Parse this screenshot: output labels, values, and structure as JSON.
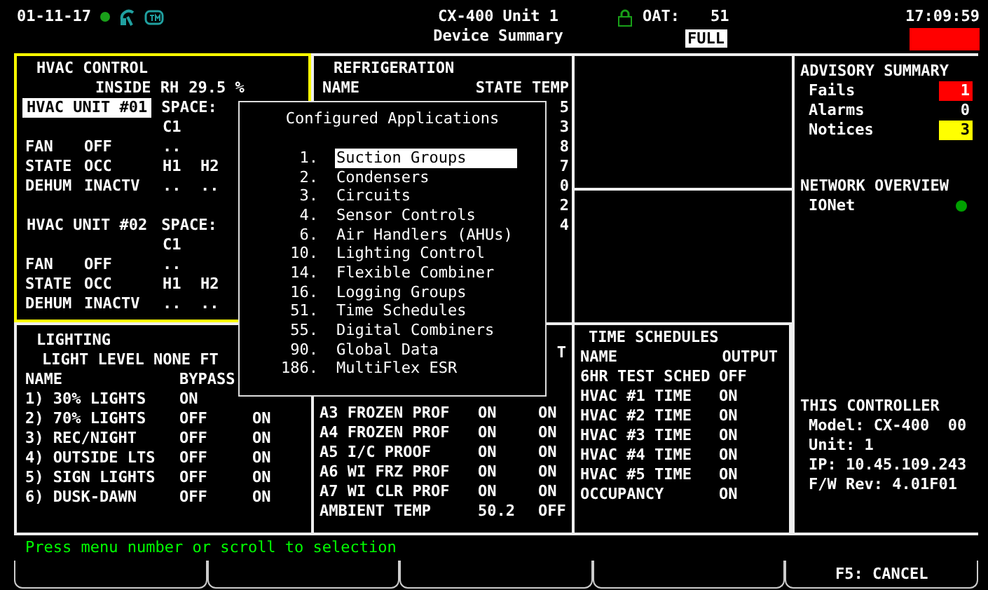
{
  "header": {
    "date": "01-11-17",
    "title": "CX-400 Unit 1",
    "subtitle": "Device Summary",
    "oat_label": "OAT:",
    "oat_value": "51",
    "time": "17:09:59",
    "mode_badge": "FULL",
    "alarm_active": true
  },
  "hvac_control": {
    "title": "HVAC CONTROL",
    "highlighted": true,
    "inside_rh_label": "INSIDE RH",
    "inside_rh": "29.5 %",
    "units": [
      {
        "name": "HVAC UNIT #01",
        "selected": true,
        "space_label": "SPACE:",
        "rows": [
          {
            "stages": [
              "C1"
            ]
          },
          {
            "label": "FAN",
            "value": "OFF",
            "stages": [
              ".."
            ]
          },
          {
            "label": "STATE",
            "value": "OCC",
            "stages": [
              "H1",
              "H2"
            ]
          },
          {
            "label": "DEHUM",
            "value": "INACTV",
            "stages": [
              "..",
              ".."
            ]
          }
        ]
      },
      {
        "name": "HVAC UNIT #02",
        "selected": false,
        "space_label": "SPACE:",
        "rows": [
          {
            "stages": [
              "C1"
            ]
          },
          {
            "label": "FAN",
            "value": "OFF",
            "stages": [
              ".."
            ]
          },
          {
            "label": "STATE",
            "value": "OCC",
            "stages": [
              "H1",
              "H2"
            ]
          },
          {
            "label": "DEHUM",
            "value": "INACTV",
            "stages": [
              "..",
              ".."
            ]
          }
        ]
      }
    ]
  },
  "refrigeration": {
    "title": "REFRIGERATION",
    "columns": [
      "NAME",
      "STATE",
      "TEMP"
    ],
    "temps": [
      "5",
      "3",
      "8",
      "7",
      "0",
      "2",
      "4"
    ]
  },
  "refrigeration_lower": {
    "column_tail": "T",
    "rows": [
      {
        "name": "A3 FROZEN PROF",
        "state": "ON",
        "output": "ON"
      },
      {
        "name": "A4 FROZEN PROF",
        "state": "ON",
        "output": "ON"
      },
      {
        "name": "A5 I/C PROOF",
        "state": "ON",
        "output": "ON"
      },
      {
        "name": "A6 WI FRZ PROF",
        "state": "ON",
        "output": "ON"
      },
      {
        "name": "A7 WI CLR PROF",
        "state": "ON",
        "output": "ON"
      },
      {
        "name": "AMBIENT TEMP",
        "state": "50.2",
        "output": "OFF"
      }
    ]
  },
  "lighting": {
    "title": "LIGHTING",
    "subtitle": "LIGHT LEVEL NONE FT",
    "columns": [
      "NAME",
      "BYPASS"
    ],
    "rows": [
      {
        "name": "1) 30% LIGHTS",
        "bypass": "ON"
      },
      {
        "name": "2) 70% LIGHTS",
        "bypass": "OFF",
        "output": "ON"
      },
      {
        "name": "3) REC/NIGHT",
        "bypass": "OFF",
        "output": "ON"
      },
      {
        "name": "4) OUTSIDE LTS",
        "bypass": "OFF",
        "output": "ON"
      },
      {
        "name": "5) SIGN LIGHTS",
        "bypass": "OFF",
        "output": "ON"
      },
      {
        "name": "6) DUSK-DAWN",
        "bypass": "OFF",
        "output": "ON"
      }
    ]
  },
  "time_schedules": {
    "title": "TIME SCHEDULES",
    "columns": [
      "NAME",
      "OUTPUT"
    ],
    "rows": [
      {
        "name": "6HR TEST SCHED",
        "output": "OFF"
      },
      {
        "name": "HVAC #1 TIME",
        "output": "ON"
      },
      {
        "name": "HVAC #2 TIME",
        "output": "ON"
      },
      {
        "name": "HVAC #3 TIME",
        "output": "ON"
      },
      {
        "name": "HVAC #4 TIME",
        "output": "ON"
      },
      {
        "name": "HVAC #5 TIME",
        "output": "ON"
      },
      {
        "name": "OCCUPANCY",
        "output": "ON"
      }
    ]
  },
  "advisory_summary": {
    "title": "ADVISORY SUMMARY",
    "items": [
      {
        "label": "Fails",
        "count": "1",
        "color": "#ff0000"
      },
      {
        "label": "Alarms",
        "count": "0"
      },
      {
        "label": "Notices",
        "count": "3",
        "color": "#ffff00"
      }
    ]
  },
  "network_overview": {
    "title": "NETWORK OVERVIEW",
    "items": [
      {
        "name": "IONet",
        "color": "#00a000"
      }
    ]
  },
  "this_controller": {
    "title": "THIS CONTROLLER",
    "lines": [
      "Model: CX-400  00",
      "Unit: 1",
      "IP: 10.45.109.243",
      "F/W Rev: 4.01F01"
    ]
  },
  "popup": {
    "title": "Configured Applications",
    "items": [
      {
        "number": "1.",
        "label": "Suction Groups",
        "selected": true
      },
      {
        "number": "2.",
        "label": "Condensers",
        "selected": false
      },
      {
        "number": "3.",
        "label": "Circuits",
        "selected": false
      },
      {
        "number": "4.",
        "label": "Sensor Controls",
        "selected": false
      },
      {
        "number": "6.",
        "label": "Air Handlers (AHUs)",
        "selected": false
      },
      {
        "number": "10.",
        "label": "Lighting Control",
        "selected": false
      },
      {
        "number": "14.",
        "label": "Flexible Combiner",
        "selected": false
      },
      {
        "number": "16.",
        "label": "Logging Groups",
        "selected": false
      },
      {
        "number": "51.",
        "label": "Time Schedules",
        "selected": false
      },
      {
        "number": "55.",
        "label": "Digital Combiners",
        "selected": false
      },
      {
        "number": "90.",
        "label": "Global Data",
        "selected": false
      },
      {
        "number": "186.",
        "label": "MultiFlex ESR",
        "selected": false
      }
    ]
  },
  "status_bar": {
    "message": "Press menu number or scroll to selection"
  },
  "softkeys": [
    {
      "kind": "blank"
    },
    {
      "kind": "blank"
    },
    {
      "kind": "blank"
    },
    {
      "kind": "blank"
    },
    {
      "kind": "labeled",
      "label": "F5: CANCEL"
    }
  ]
}
